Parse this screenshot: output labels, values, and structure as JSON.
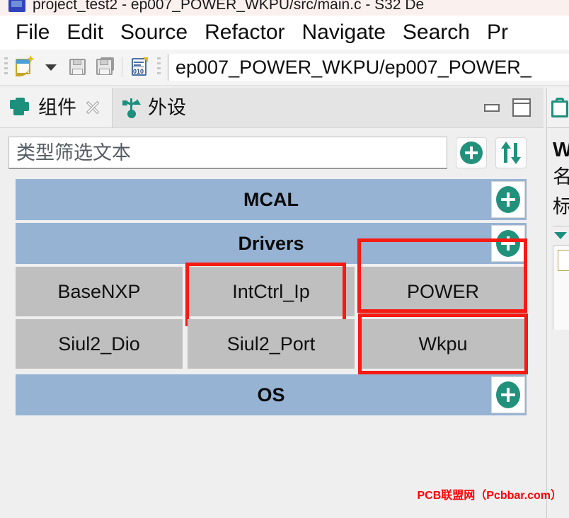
{
  "window": {
    "title": "project_test2 - ep007_POWER_WKPU/src/main.c - S32 De",
    "app_icon": "s32-design-studio-icon"
  },
  "menubar": {
    "items": [
      {
        "label": "File"
      },
      {
        "label": "Edit"
      },
      {
        "label": "Source"
      },
      {
        "label": "Refactor"
      },
      {
        "label": "Navigate"
      },
      {
        "label": "Search"
      },
      {
        "label": "Pr"
      }
    ]
  },
  "toolbar": {
    "new_icon": "new-file-icon",
    "dropdown_icon": "chevron-down-icon",
    "save_icon": "save-icon",
    "save_all_icon": "save-all-icon",
    "hex_icon": "binary-file-icon",
    "path_value": "ep007_POWER_WKPU/ep007_POWER_"
  },
  "view_tabs": {
    "tabs": [
      {
        "label": "组件",
        "icon": "components-icon",
        "active": true,
        "closable": true
      },
      {
        "label": "外设",
        "icon": "usb-peripherals-icon",
        "active": false,
        "closable": false
      }
    ],
    "minimize_label": "minimize",
    "maximize_label": "maximize"
  },
  "filter": {
    "placeholder": "类型筛选文本",
    "value": "",
    "add_button": "add-component-button",
    "sort_button": "sort-toggle-button"
  },
  "tree": {
    "groups": [
      {
        "name": "MCAL",
        "add_icon": "add-icon",
        "rows": []
      },
      {
        "name": "Drivers",
        "add_icon": "add-icon",
        "rows": [
          [
            {
              "label": "BaseNXP",
              "highlighted": false
            },
            {
              "label": "IntCtrl_Ip",
              "highlighted": true
            },
            {
              "label": "POWER",
              "highlighted": true
            }
          ],
          [
            {
              "label": "Siul2_Dio",
              "highlighted": false
            },
            {
              "label": "Siul2_Port",
              "highlighted": false
            },
            {
              "label": "Wkpu",
              "highlighted": true
            }
          ]
        ]
      },
      {
        "name": "OS",
        "add_icon": "add-icon",
        "rows": []
      }
    ]
  },
  "right_panel": {
    "tab_icon": "clipboard-icon",
    "heading": "W",
    "row1": "名",
    "row2": "标",
    "caret_icon": "caret-down-icon"
  },
  "watermark": {
    "text": "PCB联盟网（Pcbbar.com）"
  },
  "colors": {
    "group_header": "#96b3d4",
    "tile": "#bfbfbf",
    "accent_green": "#22917c",
    "annotation_red": "#f51b12",
    "panel_bg": "#efefef",
    "watermark_red": "#ff0000"
  }
}
